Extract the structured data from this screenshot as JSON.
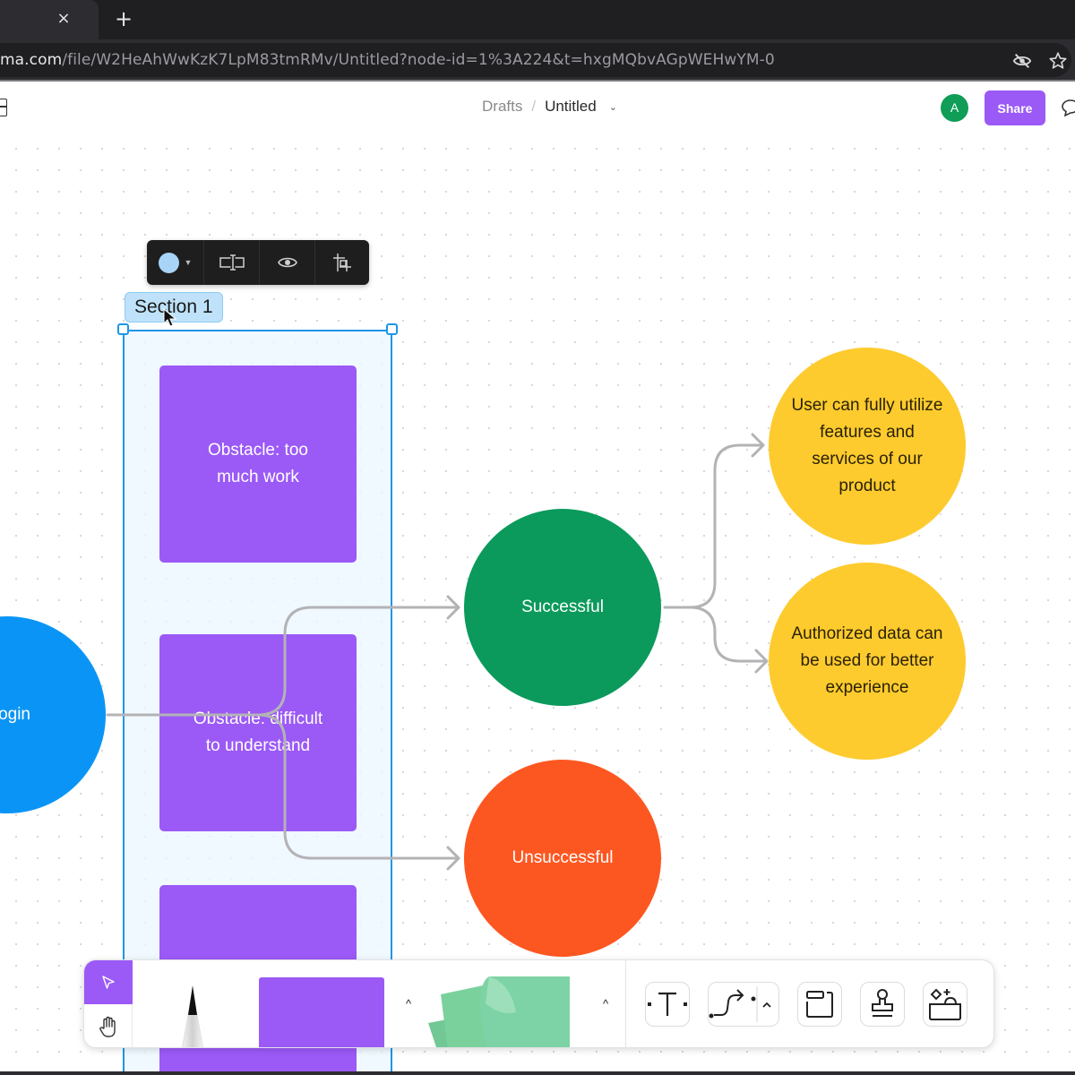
{
  "browser": {
    "tab_close_glyph": "×",
    "new_tab_glyph": "+",
    "url_host": "ma.com",
    "url_path": "/file/W2HeAhWwKzK7LpM83tmRMv/Untitled?node-id=1%3A224&t=hxgMQbvAGpWEHwYM-0",
    "icons": [
      "eye-off-icon",
      "star-icon"
    ]
  },
  "header": {
    "breadcrumb_parent": "Drafts",
    "breadcrumb_separator": "/",
    "file_title": "Untitled",
    "title_chevron": "⌄",
    "avatar_initial": "A",
    "share_label": "Share"
  },
  "section": {
    "label": "Section 1",
    "context_toolbar": {
      "fill_color": "#a8d4f7",
      "items": [
        "color-picker",
        "resize-to-fit",
        "visibility",
        "auto-layout"
      ]
    }
  },
  "nodes": {
    "login": {
      "label": "Login",
      "visible_text": "ogin",
      "color": "#0a95f6"
    },
    "obstacle_1": {
      "label": "Obstacle: too much work",
      "color": "#9b59f6"
    },
    "obstacle_2": {
      "label": "Obstacle: difficult to understand",
      "color": "#9b59f6"
    },
    "obstacle_3": {
      "label": "",
      "color": "#9b59f6"
    },
    "successful": {
      "label": "Successful",
      "color": "#0b9a5c"
    },
    "unsuccessful": {
      "label": "Unsuccessful",
      "color": "#fd5721"
    },
    "outcome_1": {
      "label": "User can fully utilize features and services of our product",
      "color": "#fecb2e"
    },
    "outcome_2": {
      "label": "Authorized data can be used for better experience",
      "color": "#fecb2e"
    }
  },
  "connectors": [
    {
      "from": "login",
      "to": "successful"
    },
    {
      "from": "login",
      "to": "unsuccessful"
    },
    {
      "from": "successful",
      "to": "outcome_1"
    },
    {
      "from": "successful",
      "to": "outcome_2"
    }
  ],
  "toolbar": {
    "active_tool": "select",
    "tools": [
      "select",
      "hand",
      "pen",
      "shape",
      "sticky-note",
      "text",
      "connector",
      "section",
      "stamp",
      "widgets"
    ],
    "caret_glyph": "^",
    "accent": "#9b59f6",
    "sticky_color": "#7dd3a5"
  }
}
